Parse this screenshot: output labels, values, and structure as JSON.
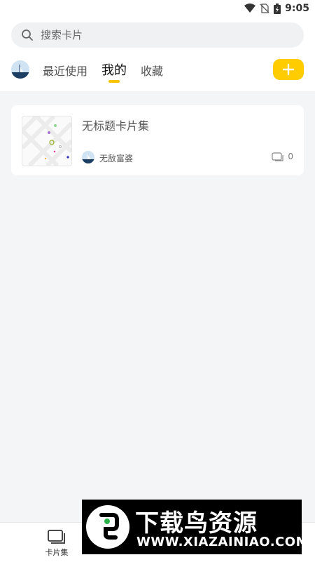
{
  "status_bar": {
    "time": "9:05"
  },
  "search": {
    "placeholder": "搜索卡片",
    "value": ""
  },
  "tabs": [
    {
      "label": "最近使用",
      "active": false
    },
    {
      "label": "我的",
      "active": true
    },
    {
      "label": "收藏",
      "active": false
    }
  ],
  "add_button": {
    "icon": "plus-icon"
  },
  "cards": [
    {
      "title": "无标题卡片集",
      "owner": "无敌富婆",
      "count": "0"
    }
  ],
  "bottom_nav": {
    "items": [
      {
        "label": "卡片集",
        "icon": "card-set-icon"
      }
    ]
  },
  "watermark": {
    "title": "下载鸟资源",
    "url": "WWW.XIAZAINIAO.COM"
  },
  "colors": {
    "accent": "#ffcc00",
    "background": "#f4f5f7"
  }
}
